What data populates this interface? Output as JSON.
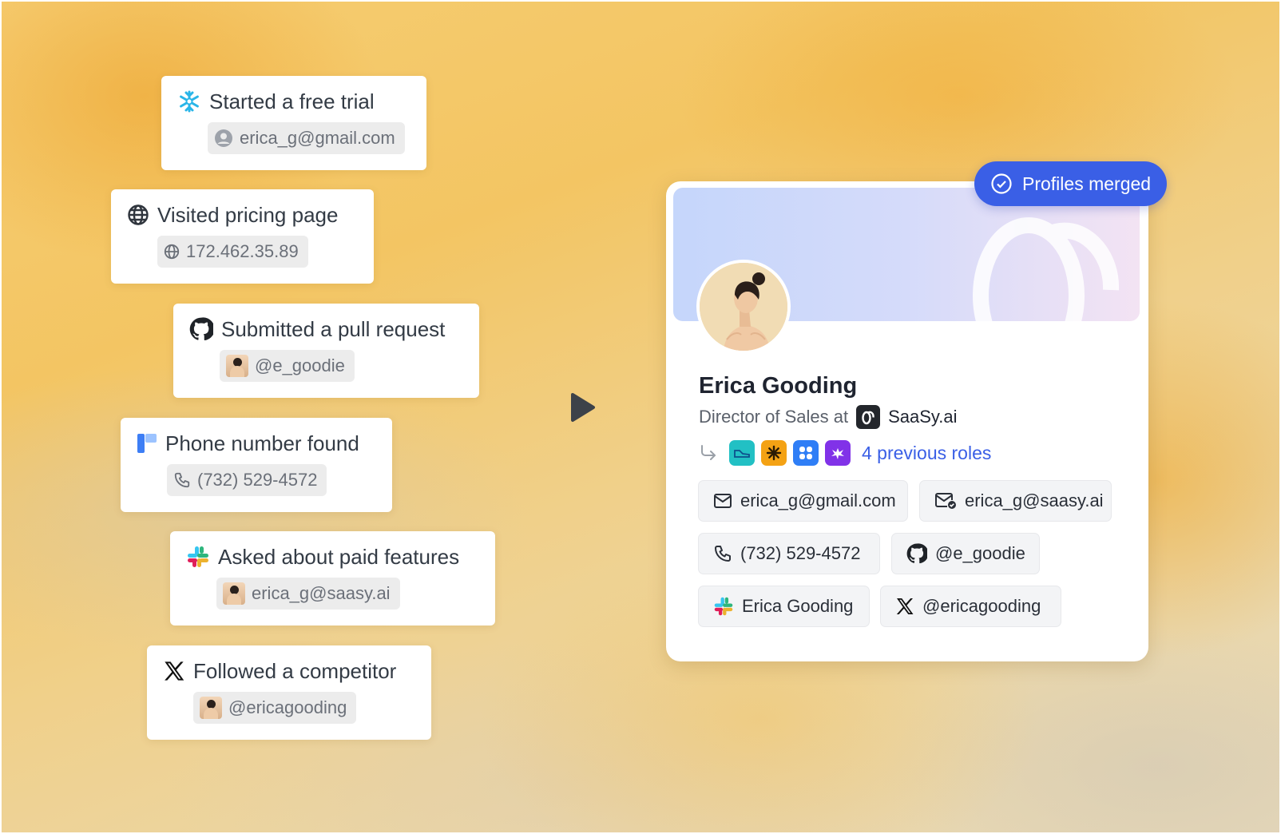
{
  "activities": [
    {
      "title": "Started a free trial",
      "chip": "erica_g@gmail.com",
      "icon": "snowflake-icon",
      "chip_icon": "user-circle-icon"
    },
    {
      "title": "Visited pricing page",
      "chip": "172.462.35.89",
      "icon": "globe-icon",
      "chip_icon": "globe-icon"
    },
    {
      "title": "Submitted a pull request",
      "chip": "@e_goodie",
      "icon": "github-icon",
      "chip_icon": "avatar"
    },
    {
      "title": "Phone number found",
      "chip": "(732) 529-4572",
      "icon": "phone-source-logo-icon",
      "chip_icon": "phone-icon"
    },
    {
      "title": "Asked about paid features",
      "chip": "erica_g@saasy.ai",
      "icon": "slack-icon",
      "chip_icon": "avatar"
    },
    {
      "title": "Followed a competitor",
      "chip": "@ericagooding",
      "icon": "x-icon",
      "chip_icon": "avatar"
    }
  ],
  "profile": {
    "badge": "Profiles merged",
    "name": "Erica Gooding",
    "role_prefix": "Director of Sales at",
    "company": "SaaSy.ai",
    "previous_roles": "4 previous roles",
    "contacts": [
      {
        "label": "erica_g@gmail.com",
        "icon": "mail-icon"
      },
      {
        "label": "erica_g@saasy.ai",
        "icon": "mail-verified-icon"
      },
      {
        "label": "(732) 529-4572",
        "icon": "phone-icon"
      },
      {
        "label": "@e_goodie",
        "icon": "github-icon"
      },
      {
        "label": "Erica Gooding",
        "icon": "slack-icon"
      },
      {
        "label": "@ericagooding",
        "icon": "x-icon"
      }
    ]
  },
  "colors": {
    "accent": "#3a5fe6",
    "card": "#ffffff"
  }
}
